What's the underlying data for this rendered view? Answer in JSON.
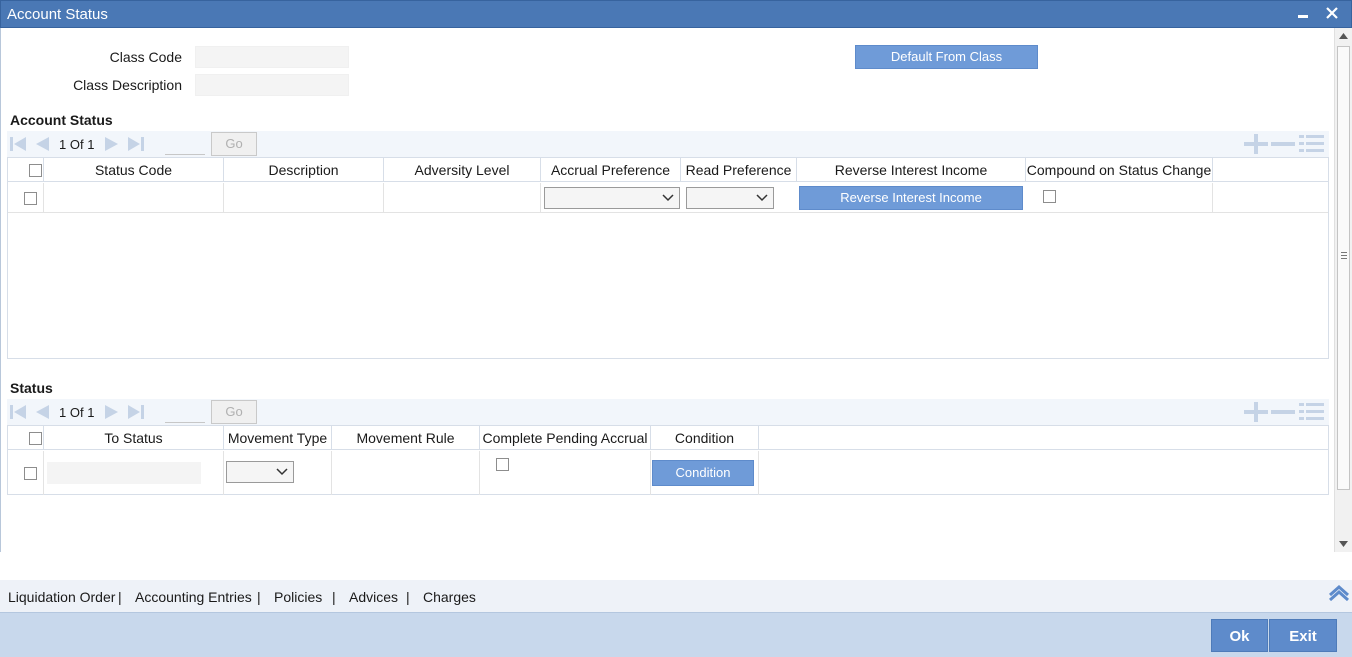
{
  "window": {
    "title": "Account Status",
    "minimize": "▁",
    "close": "✕"
  },
  "header": {
    "class_code_label": "Class Code",
    "class_code_value": "",
    "class_description_label": "Class Description",
    "class_description_value": "",
    "default_from_class": "Default From Class"
  },
  "account_status": {
    "title": "Account Status",
    "pager": {
      "page": "1",
      "of": "Of",
      "total": "1",
      "go": "Go"
    },
    "columns": [
      "Status Code",
      "Description",
      "Adversity Level",
      "Accrual Preference",
      "Read Preference",
      "Reverse Interest Income",
      "Compound on Status Change"
    ],
    "row": {
      "status_code": "",
      "description": "",
      "adversity_level": "",
      "accrual_preference": "",
      "read_preference": "",
      "reverse_button": "Reverse Interest Income"
    }
  },
  "status": {
    "title": "Status",
    "pager": {
      "page": "1",
      "of": "Of",
      "total": "1",
      "go": "Go"
    },
    "columns": [
      "To Status",
      "Movement Type",
      "Movement Rule",
      "Complete Pending Accrual",
      "Condition"
    ],
    "row": {
      "to_status": "",
      "movement_type": "",
      "movement_rule": "",
      "condition_button": "Condition"
    }
  },
  "tabs": [
    "Liquidation Order",
    "Accounting Entries",
    "Policies",
    "Advices",
    "Charges"
  ],
  "tab_separator": "|",
  "footer": {
    "ok": "Ok",
    "exit": "Exit"
  },
  "colors": {
    "title_bar": "#4a78b5",
    "button": "#6f9bd8",
    "footer": "#c8d8ec",
    "footer_button": "#5e8bcb"
  }
}
